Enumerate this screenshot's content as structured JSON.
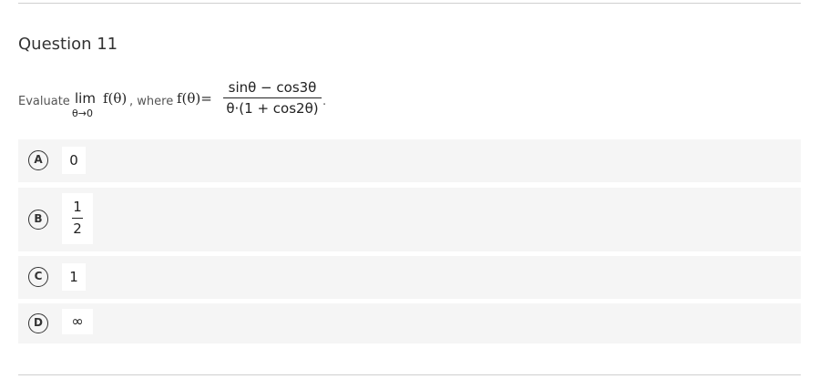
{
  "question": {
    "title": "Question 11",
    "prompt": {
      "evaluate": "Evaluate",
      "lim": "lim",
      "lim_sub": "θ→0",
      "f_arg": "f(θ)",
      "where": ", where",
      "f_def": "f(θ)=",
      "numerator": "sinθ − cos3θ",
      "denominator": "θ·(1 + cos2θ)",
      "end": "."
    }
  },
  "options": [
    {
      "letter": "A",
      "value": "0"
    },
    {
      "letter": "B",
      "numerator": "1",
      "denominator": "2"
    },
    {
      "letter": "C",
      "value": "1"
    },
    {
      "letter": "D",
      "value": "∞"
    }
  ]
}
